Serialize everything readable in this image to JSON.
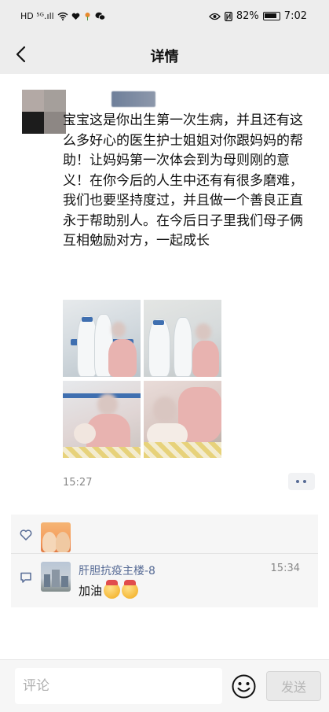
{
  "status_bar": {
    "left_indicators": "HD ⁵ᴳ.ıll",
    "battery_percent": "82%",
    "time": "7:02"
  },
  "navbar": {
    "title": "详情",
    "back_icon": "chevron-left-icon"
  },
  "post": {
    "text": "宝宝这是你出生第一次生病，并且还有这么多好心的医生护士姐姐对你跟妈妈的帮助！让妈妈第一次体会到为母则刚的意义！在你今后的人生中还有有很多磨难，我们也要坚持度过，并且做一个善良正直永于帮助别人。在今后日子里我们母子俩互相勉励对方，一起成长",
    "photo_count": 4,
    "time": "15:27",
    "more_icon": "more-dots-icon"
  },
  "interactions": {
    "like_icon": "heart-icon",
    "comment_icon": "comment-bubble-icon",
    "comment": {
      "author": "肝胆抗疫主楼-8",
      "time": "15:34",
      "text": "加油"
    }
  },
  "bottom_bar": {
    "input_placeholder": "评论",
    "emoji_icon": "smiley-face-icon",
    "send_label": "发送"
  },
  "colors": {
    "link_blue": "#576b95",
    "background": "#f3f3f3",
    "meta_gray": "#888888"
  }
}
